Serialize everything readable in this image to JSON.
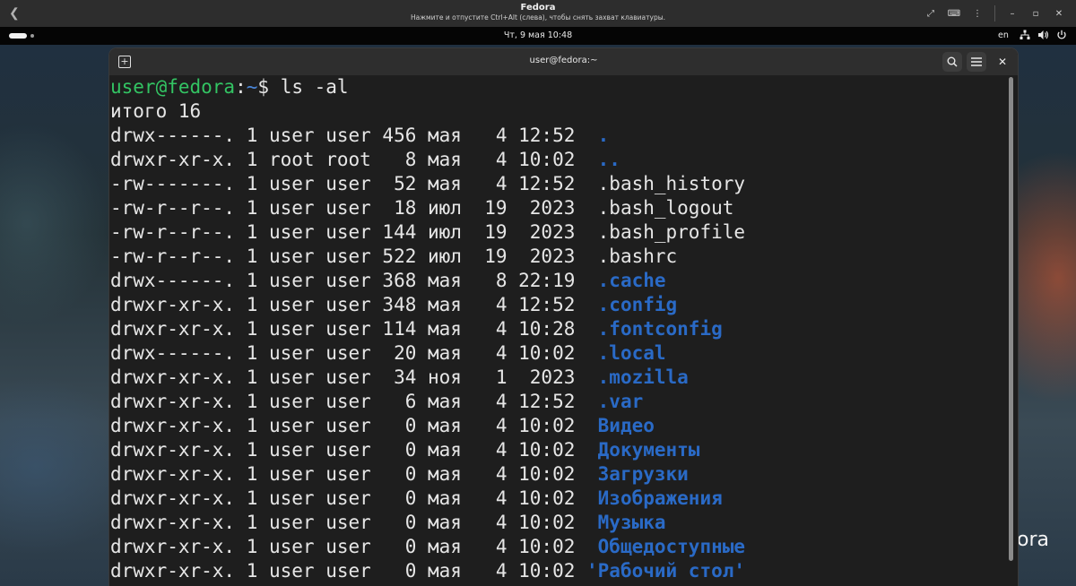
{
  "vm_header": {
    "title": "Fedora",
    "subtitle": "Нажмите и отпустите Ctrl+Alt (слева), чтобы снять захват клавиатуры."
  },
  "topbar": {
    "clock": "Чт, 9 мая  10:48",
    "keyboard_layout": "en"
  },
  "desktop": {
    "logo_fragment": "ora"
  },
  "terminal": {
    "title": "user@fedora:~",
    "prompt": {
      "user_host": "user@fedora",
      "separator": ":",
      "path": "~",
      "symbol": "$ ",
      "command": "ls -al"
    },
    "total_line": "итого 16",
    "rows": [
      {
        "meta": "drwx------. 1 user user 456 мая   4 12:52  ",
        "name": ".",
        "type": "dir"
      },
      {
        "meta": "drwxr-xr-x. 1 root root   8 мая   4 10:02  ",
        "name": "..",
        "type": "dir"
      },
      {
        "meta": "-rw-------. 1 user user  52 мая   4 12:52  ",
        "name": ".bash_history",
        "type": "file"
      },
      {
        "meta": "-rw-r--r--. 1 user user  18 июл  19  2023  ",
        "name": ".bash_logout",
        "type": "file"
      },
      {
        "meta": "-rw-r--r--. 1 user user 144 июл  19  2023  ",
        "name": ".bash_profile",
        "type": "file"
      },
      {
        "meta": "-rw-r--r--. 1 user user 522 июл  19  2023  ",
        "name": ".bashrc",
        "type": "file"
      },
      {
        "meta": "drwx------. 1 user user 368 мая   8 22:19  ",
        "name": ".cache",
        "type": "dir"
      },
      {
        "meta": "drwxr-xr-x. 1 user user 348 мая   4 12:52  ",
        "name": ".config",
        "type": "dir"
      },
      {
        "meta": "drwxr-xr-x. 1 user user 114 мая   4 10:28  ",
        "name": ".fontconfig",
        "type": "dir"
      },
      {
        "meta": "drwx------. 1 user user  20 мая   4 10:02  ",
        "name": ".local",
        "type": "dir"
      },
      {
        "meta": "drwxr-xr-x. 1 user user  34 ноя   1  2023  ",
        "name": ".mozilla",
        "type": "dir"
      },
      {
        "meta": "drwxr-xr-x. 1 user user   6 мая   4 12:52  ",
        "name": ".var",
        "type": "dir"
      },
      {
        "meta": "drwxr-xr-x. 1 user user   0 мая   4 10:02  ",
        "name": "Видео",
        "type": "dir"
      },
      {
        "meta": "drwxr-xr-x. 1 user user   0 мая   4 10:02  ",
        "name": "Документы",
        "type": "dir"
      },
      {
        "meta": "drwxr-xr-x. 1 user user   0 мая   4 10:02  ",
        "name": "Загрузки",
        "type": "dir"
      },
      {
        "meta": "drwxr-xr-x. 1 user user   0 мая   4 10:02  ",
        "name": "Изображения",
        "type": "dir"
      },
      {
        "meta": "drwxr-xr-x. 1 user user   0 мая   4 10:02  ",
        "name": "Музыка",
        "type": "dir"
      },
      {
        "meta": "drwxr-xr-x. 1 user user   0 мая   4 10:02  ",
        "name": "Общедоступные",
        "type": "dir"
      },
      {
        "meta": "drwxr-xr-x. 1 user user   0 мая   4 10:02 ",
        "name": "'Рабочий стол'",
        "type": "dir"
      }
    ]
  },
  "colors": {
    "prompt_user": "#33c463",
    "prompt_path": "#4a86d9",
    "directory": "#2a6ac6",
    "terminal_bg": "#1e1e1e"
  },
  "icons": {
    "vm_back": "chevron-left-icon",
    "vm_controls": [
      "fullscreen-icon",
      "keyboard-icon",
      "menu-dots-icon",
      "minimize-icon",
      "restore-icon",
      "close-icon"
    ],
    "tray": [
      "network-icon",
      "volume-icon",
      "power-icon"
    ],
    "terminal_header": [
      "new-tab-icon",
      "search-icon",
      "hamburger-menu-icon",
      "close-icon"
    ]
  }
}
